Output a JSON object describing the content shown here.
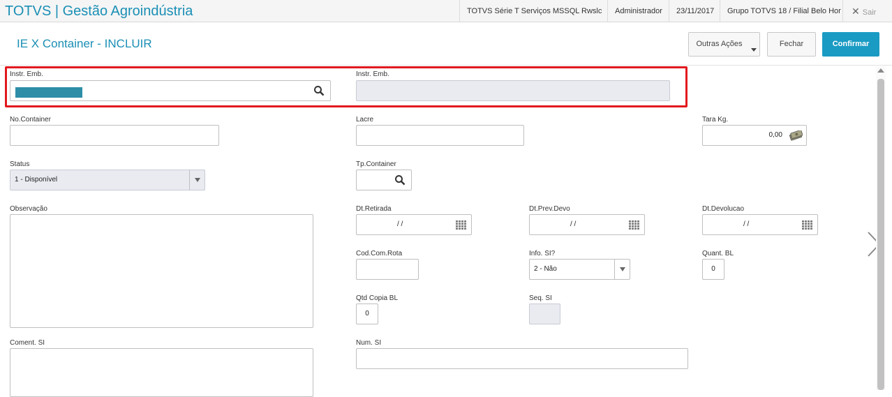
{
  "topbar": {
    "app_title": "TOTVS | Gestão Agroindústria",
    "system": "TOTVS Série T Serviços MSSQL Rwslc",
    "user": "Administrador",
    "date": "23/11/2017",
    "branch": "Grupo TOTVS 18 / Filial Belo Hor",
    "exit_label": "Sair"
  },
  "header": {
    "title": "IE X Container - INCLUIR",
    "more_actions": "Outras Ações",
    "close": "Fechar",
    "confirm": "Confirmar"
  },
  "colors": {
    "brand": "#1a8fb5",
    "confirm": "#1a9bc4",
    "highlight": "#e2191e"
  },
  "form": {
    "instr_emb_code": {
      "label": "Instr. Emb.",
      "value": ""
    },
    "instr_emb_desc": {
      "label": "Instr. Emb.",
      "value": ""
    },
    "container_no": {
      "label": "No.Container",
      "value": ""
    },
    "seal": {
      "label": "Lacre",
      "value": ""
    },
    "tare": {
      "label": "Tara Kg.",
      "value": "0,00"
    },
    "status": {
      "label": "Status",
      "value": "1 - Disponível"
    },
    "container_type": {
      "label": "Tp.Container",
      "value": ""
    },
    "notes": {
      "label": "Observação",
      "value": ""
    },
    "pickup_date": {
      "label": "Dt.Retirada",
      "value": "/ /"
    },
    "expected_return": {
      "label": "Dt.Prev.Devo",
      "value": "/ /"
    },
    "return_date": {
      "label": "Dt.Devolucao",
      "value": "/ /"
    },
    "route_code": {
      "label": "Cod.Com.Rota",
      "value": ""
    },
    "si_info": {
      "label": "Info. SI?",
      "value": "2 - Não"
    },
    "bl_qty": {
      "label": "Quant.  BL",
      "value": "0"
    },
    "bl_copy_qty": {
      "label": "Qtd Copia BL",
      "value": "0"
    },
    "si_seq": {
      "label": "Seq. SI",
      "value": ""
    },
    "si_comment": {
      "label": "Coment. SI",
      "value": ""
    },
    "si_number": {
      "label": "Num. SI",
      "value": ""
    }
  }
}
